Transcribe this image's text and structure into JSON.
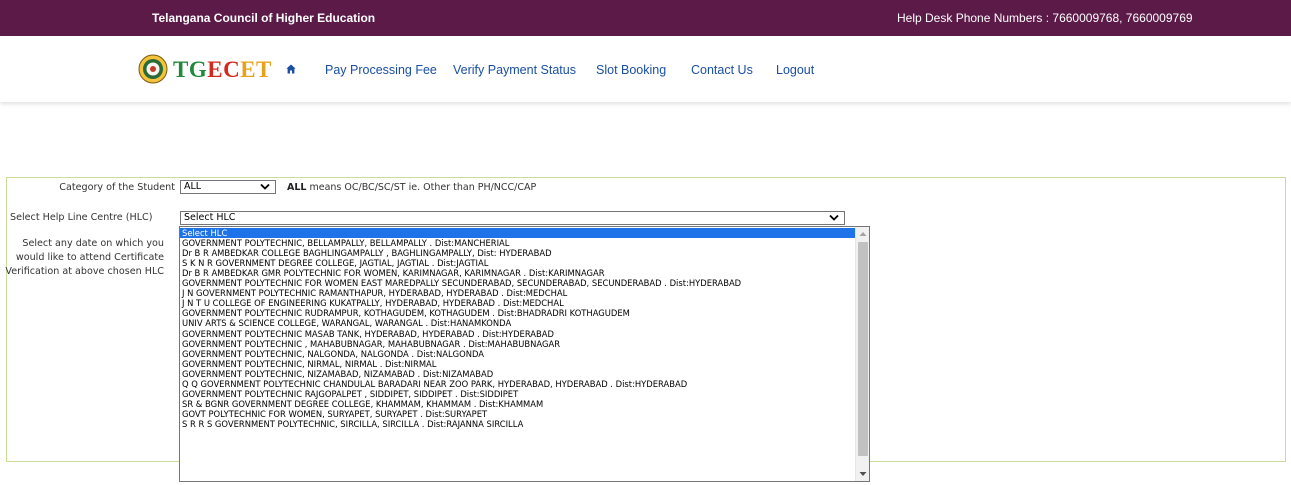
{
  "topbar": {
    "org_name": "Telangana Council of Higher Education",
    "helpdesk": "Help Desk Phone Numbers : 7660009768, 7660009769",
    "bg_color": "#5b1a48"
  },
  "brand": {
    "part1": "TG",
    "part2": "EC",
    "part3": "ET",
    "logo_icon": "emblem-icon"
  },
  "nav": {
    "home_icon": "home-icon",
    "items": [
      {
        "label": "Pay Processing Fee"
      },
      {
        "label": "Verify Payment Status"
      },
      {
        "label": "Slot Booking"
      },
      {
        "label": "Contact Us"
      },
      {
        "label": "Logout"
      }
    ]
  },
  "form": {
    "category_label": "Category of the Student",
    "category_value": "ALL",
    "category_note_bold": "ALL",
    "category_note": " means OC/BC/SC/ST ie. Other than PH/NCC/CAP",
    "hlc_label": "Select Help Line Centre (HLC)",
    "hlc_value": "Select HLC",
    "date_label_lines": [
      "Select any date on which you",
      "would like to attend Certificate",
      "Verification at above chosen HLC"
    ]
  },
  "dropdown": {
    "selected_index": 0,
    "options": [
      "Select HLC",
      "GOVERNMENT POLYTECHNIC, BELLAMPALLY, BELLAMPALLY . Dist:MANCHERIAL",
      "Dr B R AMBEDKAR COLLEGE BAGHLINGAMPALLY , BAGHLINGAMPALLY, Dist: HYDERABAD",
      "S K N R GOVERNMENT DEGREE COLLEGE, JAGTIAL, JAGTIAL . Dist:JAGTIAL",
      "Dr B R AMBEDKAR GMR POLYTECHNIC FOR WOMEN, KARIMNAGAR, KARIMNAGAR . Dist:KARIMNAGAR",
      "GOVERNMENT POLYTECHNIC FOR WOMEN EAST MAREDPALLY SECUNDERABAD, SECUNDERABAD, SECUNDERABAD . Dist:HYDERABAD",
      "J N GOVERNMENT POLYTECHNIC RAMANTHAPUR, HYDERABAD, HYDERABAD . Dist:MEDCHAL",
      "J N T U COLLEGE OF ENGINEERING KUKATPALLY, HYDERABAD, HYDERABAD . Dist:MEDCHAL",
      "GOVERNMENT POLYTECHNIC RUDRAMPUR, KOTHAGUDEM, KOTHAGUDEM . Dist:BHADRADRI KOTHAGUDEM",
      "UNIV ARTS & SCIENCE COLLEGE, WARANGAL, WARANGAL . Dist:HANAMKONDA",
      "GOVERNMENT POLYTECHNIC MASAB TANK, HYDERABAD, HYDERABAD . Dist:HYDERABAD",
      "GOVERNMENT POLYTECHNIC , MAHABUBNAGAR, MAHABUBNAGAR . Dist:MAHABUBNAGAR",
      "GOVERNMENT POLYTECHNIC, NALGONDA, NALGONDA . Dist:NALGONDA",
      "GOVERNMENT POLYTECHNIC, NIRMAL, NIRMAL . Dist:NIRMAL",
      "GOVERNMENT POLYTECHNIC, NIZAMABAD, NIZAMABAD . Dist:NIZAMABAD",
      "Q Q GOVERNMENT POLYTECHNIC CHANDULAL BARADARI NEAR ZOO PARK, HYDERABAD, HYDERABAD . Dist:HYDERABAD",
      "GOVERNMENT POLYTECHNIC RAJGOPALPET , SIDDIPET, SIDDIPET . Dist:SIDDIPET",
      "SR & BGNR GOVERNMENT DEGREE COLLEGE, KHAMMAM, KHAMMAM . Dist:KHAMMAM",
      "GOVT POLYTECHNIC FOR WOMEN, SURYAPET, SURYAPET . Dist:SURYAPET",
      "S R R S GOVERNMENT POLYTECHNIC, SIRCILLA, SIRCILLA . Dist:RAJANNA SIRCILLA"
    ]
  }
}
